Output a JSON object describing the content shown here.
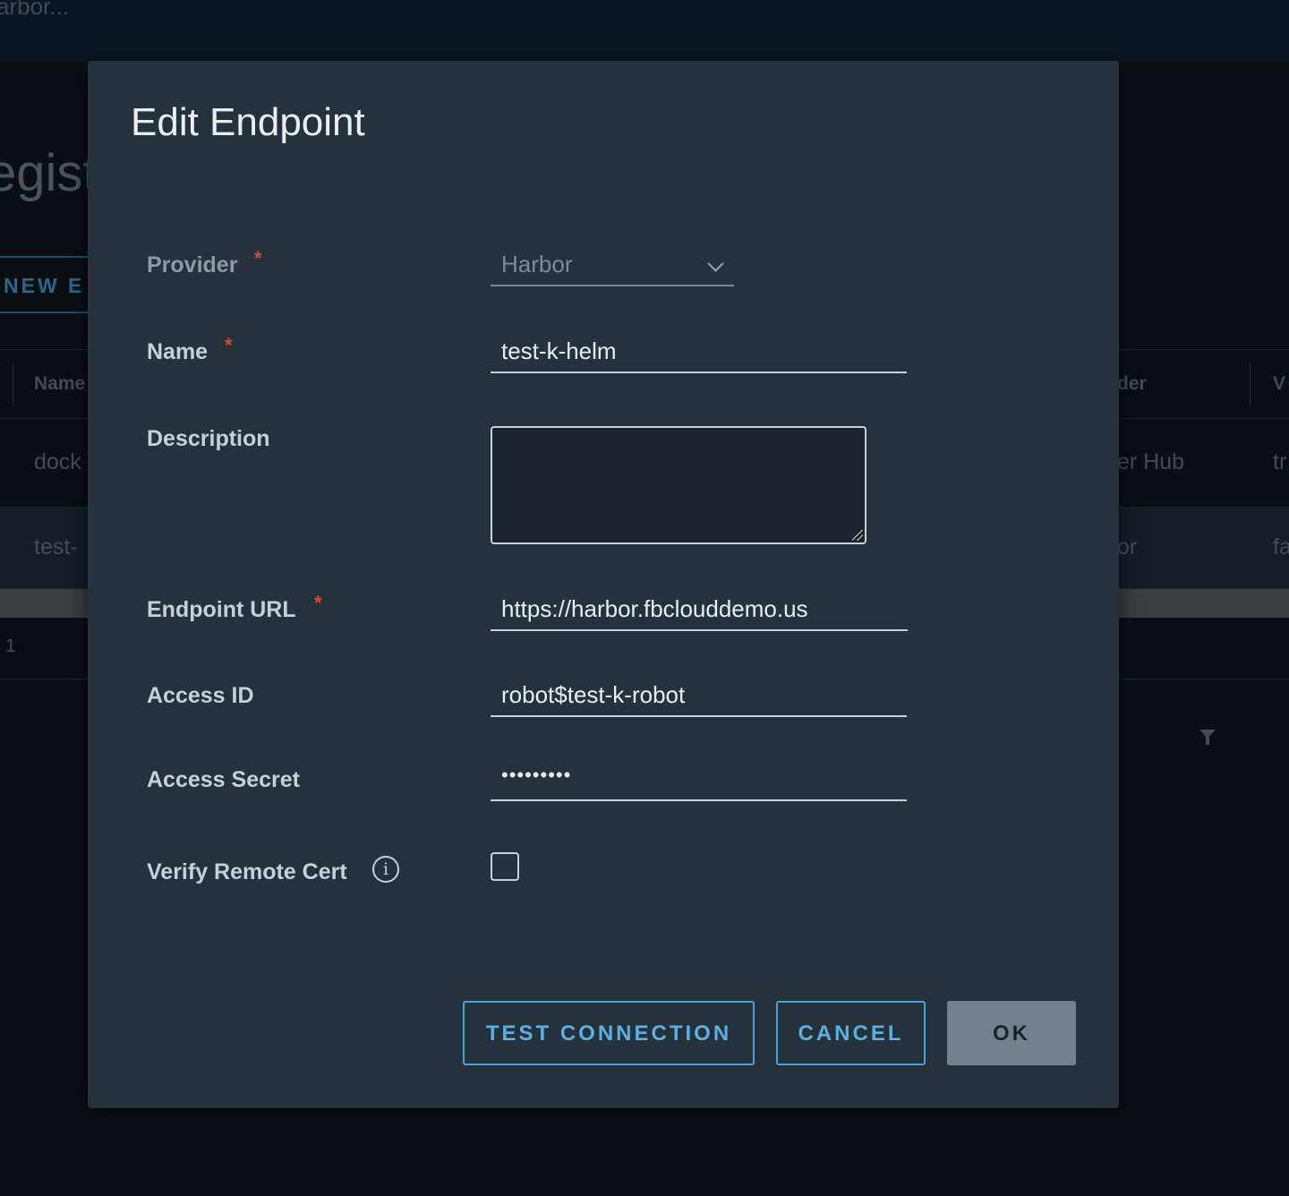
{
  "background": {
    "header_text": "arbor...",
    "page_title": "egist",
    "new_button": "NEW E",
    "grid_headers": {
      "name": "Name",
      "provider": "der",
      "v": "V"
    },
    "rows": [
      {
        "name": "dock",
        "provider": "er Hub",
        "v": "tr"
      },
      {
        "name": "test-",
        "provider": "or",
        "v": "fa"
      }
    ],
    "pagination": "1"
  },
  "modal": {
    "title": "Edit Endpoint",
    "fields": {
      "provider": {
        "label": "Provider",
        "required": "*",
        "value": "Harbor"
      },
      "name": {
        "label": "Name",
        "required": "*",
        "value": "test-k-helm"
      },
      "description": {
        "label": "Description",
        "value": ""
      },
      "endpoint_url": {
        "label": "Endpoint URL",
        "required": "*",
        "value": "https://harbor.fbclouddemo.us"
      },
      "access_id": {
        "label": "Access ID",
        "value": "robot$test-k-robot"
      },
      "access_secret": {
        "label": "Access Secret",
        "value": "•••••••••"
      },
      "verify_cert": {
        "label": "Verify Remote Cert",
        "info": "i",
        "checked": false
      }
    },
    "buttons": {
      "test_connection": "TEST CONNECTION",
      "cancel": "CANCEL",
      "ok": "OK"
    }
  },
  "colors": {
    "modal_bg": "#25323c",
    "accent": "#49a3d8",
    "required": "#d94a33"
  }
}
